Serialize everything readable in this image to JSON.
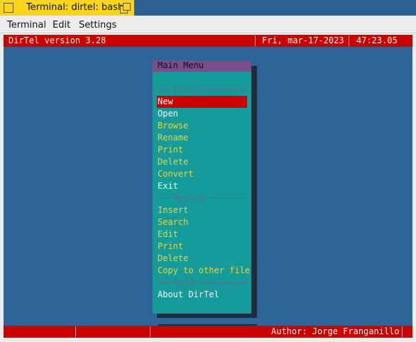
{
  "window": {
    "title": "Terminal: dirtel: bash"
  },
  "menubar": {
    "items": [
      "Terminal",
      "Edit",
      "Settings"
    ]
  },
  "status_top": {
    "app_version": "DirTel version 3.28",
    "date": "Fri, mar-17-2023",
    "time": "47:23.05"
  },
  "main_menu": {
    "title": "Main Menu",
    "sections": [
      {
        "label": "File",
        "items": [
          "New",
          "Open",
          "Browse",
          "Rename",
          "Print",
          "Delete",
          "Convert",
          "Exit"
        ]
      },
      {
        "label": "Record",
        "items": [
          "Insert",
          "Search",
          "Edit",
          "Print",
          "Delete",
          "Copy to other file"
        ]
      },
      {
        "label": "Help",
        "items": [
          "About DirTel"
        ]
      }
    ],
    "selected_item": "New"
  },
  "status_bottom": {
    "author": "Author: Jorge Franganillo"
  },
  "colors": {
    "terminal_bg": "#2f6497",
    "status_bar": "#cc0000",
    "menu_bg": "#169b9b",
    "menu_title_bg": "#7a4e8c",
    "menu_item_text": "#e8d43a",
    "selection": "#cc0000",
    "title_tab": "#f9d51c"
  }
}
